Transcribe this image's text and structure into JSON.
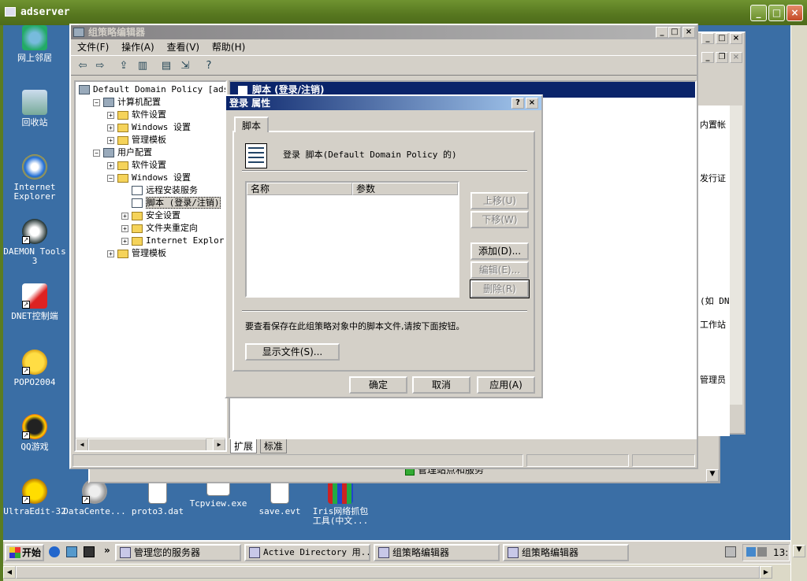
{
  "remote": {
    "title": "adserver"
  },
  "desktop_icons": [
    {
      "label": "网上邻居",
      "icon": "network-icon"
    },
    {
      "label": "回收站",
      "icon": "recycle-bin-icon"
    },
    {
      "label": "Internet Explorer",
      "icon": "ie-icon"
    },
    {
      "label": "DAEMON Tools 3",
      "icon": "daemon-tools-icon"
    },
    {
      "label": "DNET控制端",
      "icon": "dnet-icon"
    },
    {
      "label": "POPO2004",
      "icon": "popo-icon"
    },
    {
      "label": "QQ游戏",
      "icon": "qq-game-icon"
    },
    {
      "label": "UltraEdit-32",
      "icon": "ultraedit-icon"
    },
    {
      "label": "DataCente...",
      "icon": "datacenter-icon"
    },
    {
      "label": "proto3.dat",
      "icon": "file-icon"
    },
    {
      "label": "Tcpview.exe",
      "icon": "exe-icon"
    },
    {
      "label": "save.evt",
      "icon": "evt-file-icon"
    },
    {
      "label": "Iris网络抓包工具(中文...",
      "icon": "iris-icon"
    }
  ],
  "gpedit": {
    "title": "组策略编辑器",
    "menus": [
      "文件(F)",
      "操作(A)",
      "查看(V)",
      "帮助(H)"
    ],
    "tree": [
      {
        "label": "Default Domain Policy [adser",
        "level": 0,
        "pm": ""
      },
      {
        "label": "计算机配置",
        "level": 1,
        "pm": "−"
      },
      {
        "label": "软件设置",
        "level": 2,
        "pm": "+"
      },
      {
        "label": "Windows 设置",
        "level": 2,
        "pm": "+"
      },
      {
        "label": "管理模板",
        "level": 2,
        "pm": "+"
      },
      {
        "label": "用户配置",
        "level": 1,
        "pm": "−"
      },
      {
        "label": "软件设置",
        "level": 2,
        "pm": "+"
      },
      {
        "label": "Windows 设置",
        "level": 2,
        "pm": "−"
      },
      {
        "label": "远程安装服务",
        "level": 3,
        "pm": ""
      },
      {
        "label": "脚本 (登录/注销)",
        "level": 3,
        "pm": ""
      },
      {
        "label": "安全设置",
        "level": 3,
        "pm": "+"
      },
      {
        "label": "文件夹重定向",
        "level": 3,
        "pm": "+"
      },
      {
        "label": "Internet Explorer 维",
        "level": 3,
        "pm": "+"
      },
      {
        "label": "管理模板",
        "level": 2,
        "pm": "+"
      }
    ],
    "right_header": "脚本 (登录/注销)",
    "tabs": [
      "扩展",
      "标准"
    ]
  },
  "bg_window_fragments": [
    "内置帐",
    "发行证",
    "(如 DN",
    "工作站",
    "管理员",
    "管理站点和服务"
  ],
  "dialog": {
    "title": "登录 属性",
    "tab": "脚本",
    "heading": "登录 脚本(Default Domain Policy 的)",
    "columns": [
      "名称",
      "参数"
    ],
    "buttons_side": [
      {
        "label": "上移(U)",
        "disabled": true
      },
      {
        "label": "下移(W)",
        "disabled": true
      },
      {
        "label": "添加(D)...",
        "disabled": false
      },
      {
        "label": "编辑(E)...",
        "disabled": true
      },
      {
        "label": "删除(R)",
        "disabled": true
      }
    ],
    "info_text": "要查看保存在此组策略对象中的脚本文件,请按下面按钮。",
    "show_files": "显示文件(S)...",
    "ok": "确定",
    "cancel": "取消",
    "apply": "应用(A)"
  },
  "taskbar": {
    "start": "开始",
    "tasks": [
      "管理您的服务器",
      "Active Directory 用...",
      "组策略编辑器",
      "组策略编辑器"
    ],
    "clock": "13:"
  }
}
